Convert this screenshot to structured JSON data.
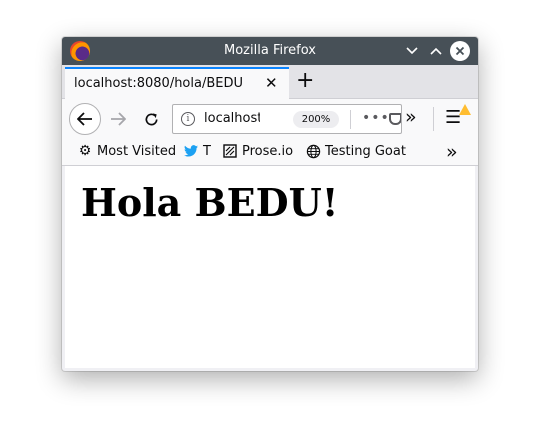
{
  "window": {
    "title": "Mozilla Firefox"
  },
  "tabs": [
    {
      "label": "localhost:8080/hola/BEDU",
      "active": true
    }
  ],
  "urlbar": {
    "text": "localhost",
    "zoom": "200%"
  },
  "bookmarks": [
    {
      "label": "Most Visited",
      "icon": "gear-icon"
    },
    {
      "label": "T",
      "icon": "twitter-bird-icon"
    },
    {
      "label": "Prose.io",
      "icon": "prose-icon"
    },
    {
      "label": "Testing Goat",
      "icon": "globe-icon"
    }
  ],
  "page": {
    "heading": "Hola BEDU!"
  },
  "colors": {
    "titlebar": "#475057",
    "active_tab_accent": "#0a84ff",
    "twitter_blue": "#1da1f2",
    "warning": "#ffbd30"
  }
}
